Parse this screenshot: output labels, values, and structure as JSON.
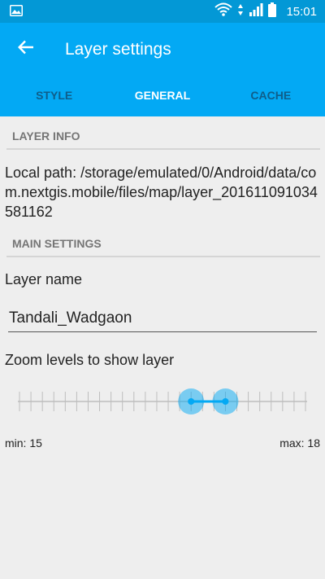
{
  "status_bar": {
    "time": "15:01",
    "icons": [
      "image-notification-icon",
      "wifi-icon",
      "data-arrows-icon",
      "signal-icon",
      "battery-icon"
    ]
  },
  "app_bar": {
    "title": "Layer settings",
    "back_icon": "arrow-back-icon"
  },
  "tabs": [
    {
      "label": "STYLE",
      "active": false
    },
    {
      "label": "GENERAL",
      "active": true
    },
    {
      "label": "CACHE",
      "active": false
    }
  ],
  "layer_info": {
    "header": "LAYER INFO",
    "local_path": "Local path: /storage/emulated/0/Android/data/com.nextgis.mobile/files/map/layer_20161109103458​1162"
  },
  "main_settings": {
    "header": "MAIN SETTINGS",
    "layer_name_label": "Layer name",
    "layer_name_value": "Tandali_Wadgaon",
    "zoom_label": "Zoom levels to show layer",
    "zoom_min_text": "min: 15",
    "zoom_max_text": "max: 18",
    "zoom_min": 15,
    "zoom_max": 18,
    "zoom_range": [
      0,
      25
    ]
  },
  "colors": {
    "primary": "#03a9f4",
    "status_bar": "#0398d6",
    "background": "#eeeeee"
  }
}
